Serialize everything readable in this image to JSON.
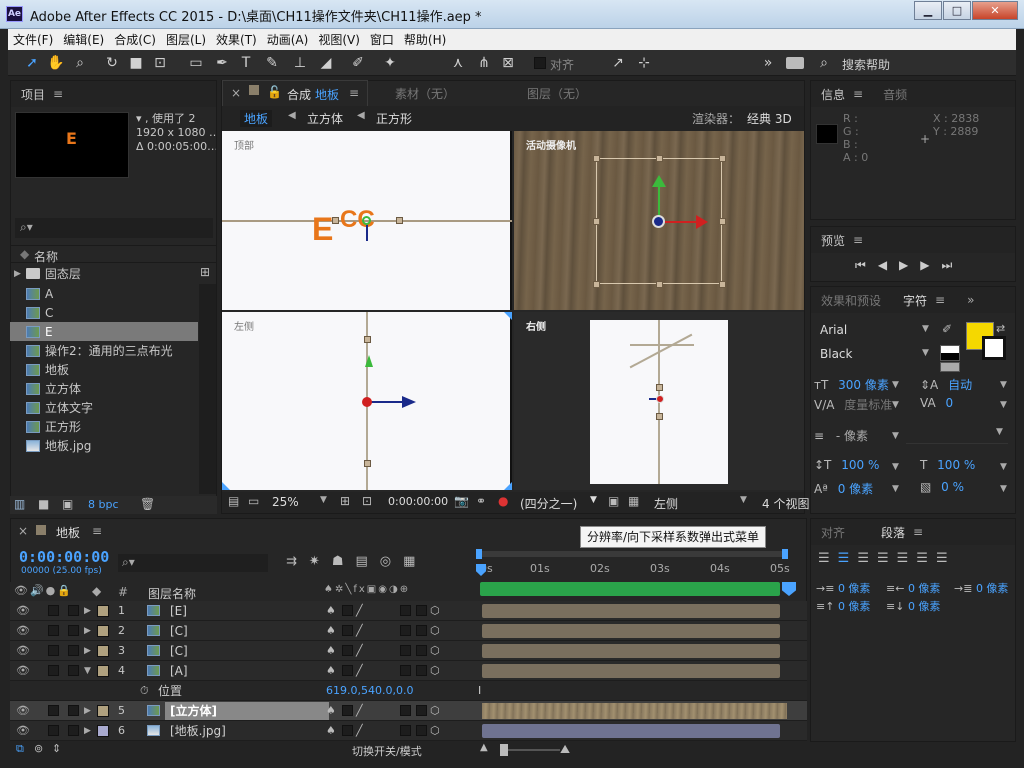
{
  "window": {
    "title": "Adobe After Effects CC 2015 - D:\\桌面\\CH11操作文件夹\\CH11操作.aep *",
    "app_icon": "Ae"
  },
  "menu": [
    "文件(F)",
    "编辑(E)",
    "合成(C)",
    "图层(L)",
    "效果(T)",
    "动画(A)",
    "视图(V)",
    "窗口",
    "帮助(H)"
  ],
  "toolbar": {
    "align_label": "对齐",
    "search_help": "搜索帮助"
  },
  "project": {
    "title": "项目",
    "thumb_letter": "E",
    "meta": [
      "▾ , 使用了 2",
      "1920 x 1080 …",
      "Δ 0:00:05:00…"
    ],
    "column_name": "名称",
    "items": [
      {
        "label": "固态层",
        "type": "folder"
      },
      {
        "label": "A"
      },
      {
        "label": "C"
      },
      {
        "label": "E"
      },
      {
        "label": "操作2：通用的三点布光"
      },
      {
        "label": "地板"
      },
      {
        "label": "立方体"
      },
      {
        "label": "立体文字"
      },
      {
        "label": "正方形"
      },
      {
        "label": "地板.jpg"
      }
    ],
    "bpc": "8 bpc"
  },
  "comp": {
    "tab_label": "合成",
    "tab_name": "地板",
    "footage_tab": "素材（无）",
    "layer_tab": "图层（无）",
    "breadcrumbs": [
      "地板",
      "立方体",
      "正方形"
    ],
    "renderer_label": "渲染器：",
    "renderer": "经典 3D",
    "views": [
      "顶部",
      "活动摄像机",
      "左侧",
      "右侧"
    ],
    "footer": {
      "zoom": "25%",
      "timecode": "0:00:00:00",
      "resolution": "(四分之一)",
      "active_view": "左侧",
      "view_layout": "4 个视图"
    }
  },
  "info": {
    "tab": "信息",
    "tab2": "音频",
    "r": "R :",
    "g": "G :",
    "b": "B :",
    "a": "A : 0",
    "x": "X : 2838",
    "y": "Y : 2889"
  },
  "preview": {
    "title": "预览"
  },
  "character": {
    "tab1": "效果和预设",
    "tab2": "字符",
    "font": "Arial",
    "style": "Black",
    "size": "300 像素",
    "leading": "自动",
    "kerning": "度量标准",
    "tracking": "0",
    "stroke": "- 像素",
    "vscale": "100 %",
    "hscale": "100 %",
    "baseline": "0 像素",
    "tsume": "0 %",
    "fill_color": "#f5d800"
  },
  "paragraph": {
    "tab1": "对齐",
    "tab2": "段落",
    "indents": [
      "0 像素",
      "0 像素",
      "0 像素",
      "0 像素",
      "0 像素"
    ]
  },
  "timeline": {
    "tab": "地板",
    "timecode": "0:00:00:00",
    "fps": "00000 (25.00 fps)",
    "tooltip": "分辨率/向下采样系数弹出式菜单",
    "col_hash": "#",
    "col_layer_name": "图层名称",
    "ruler": [
      "0s",
      "01s",
      "02s",
      "03s",
      "04s",
      "05s"
    ],
    "layers": [
      {
        "num": "1",
        "name": "[E]",
        "color": "#b0a17f"
      },
      {
        "num": "2",
        "name": "[C]",
        "color": "#b0a17f"
      },
      {
        "num": "3",
        "name": "[C]",
        "color": "#b0a17f"
      },
      {
        "num": "4",
        "name": "[A]",
        "color": "#b0a17f"
      },
      {
        "num": "5",
        "name": "[立方体]",
        "color": "#b0a17f"
      },
      {
        "num": "6",
        "name": "[地板.jpg]",
        "color": "#a9aacf"
      }
    ],
    "position_label": "位置",
    "position_value": "619.0,540.0,0.0",
    "footer_label": "切换开关/模式"
  }
}
